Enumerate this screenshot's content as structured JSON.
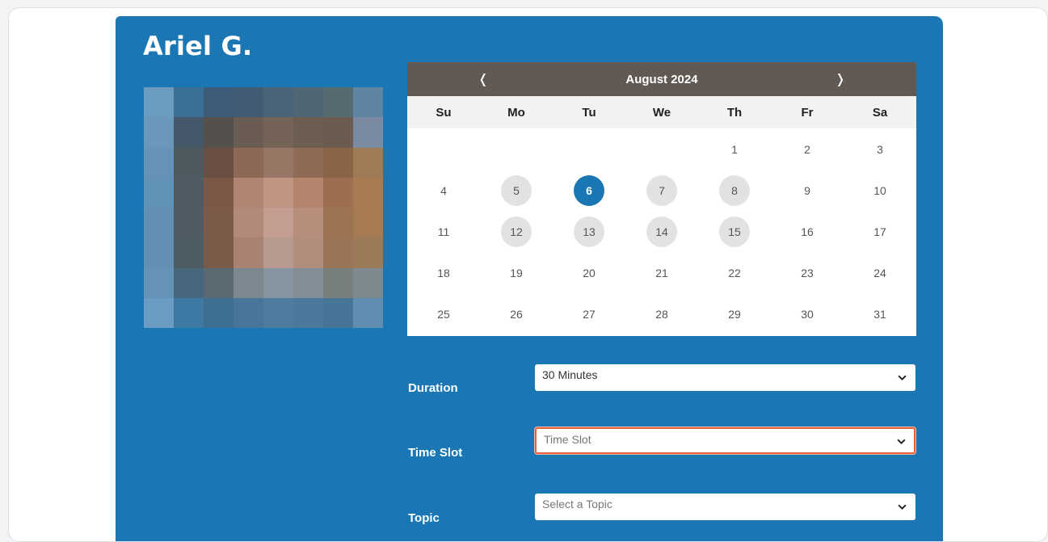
{
  "profile": {
    "name": "Ariel G."
  },
  "calendar": {
    "month_label": "August 2024",
    "prev_glyph": "❬",
    "next_glyph": "❭",
    "weekdays": [
      "Su",
      "Mo",
      "Tu",
      "We",
      "Th",
      "Fr",
      "Sa"
    ],
    "weeks": [
      [
        "",
        "",
        "",
        "",
        "1",
        "2",
        "3"
      ],
      [
        "4",
        "5",
        "6",
        "7",
        "8",
        "9",
        "10"
      ],
      [
        "11",
        "12",
        "13",
        "14",
        "15",
        "16",
        "17"
      ],
      [
        "18",
        "19",
        "20",
        "21",
        "22",
        "23",
        "24"
      ],
      [
        "25",
        "26",
        "27",
        "28",
        "29",
        "30",
        "31"
      ]
    ],
    "available_days": [
      "5",
      "7",
      "8",
      "12",
      "13",
      "14",
      "15"
    ],
    "selected_day": "6"
  },
  "form": {
    "duration": {
      "label": "Duration",
      "value": "30 Minutes"
    },
    "time_slot": {
      "label": "Time Slot",
      "placeholder": "Time Slot"
    },
    "topic": {
      "label": "Topic",
      "placeholder": "Select a Topic"
    }
  },
  "colors": {
    "panel_blue": "#1b77b4",
    "header_brown": "#615953",
    "focus_orange": "#e8603a",
    "available_grey": "#e2e2e2"
  }
}
